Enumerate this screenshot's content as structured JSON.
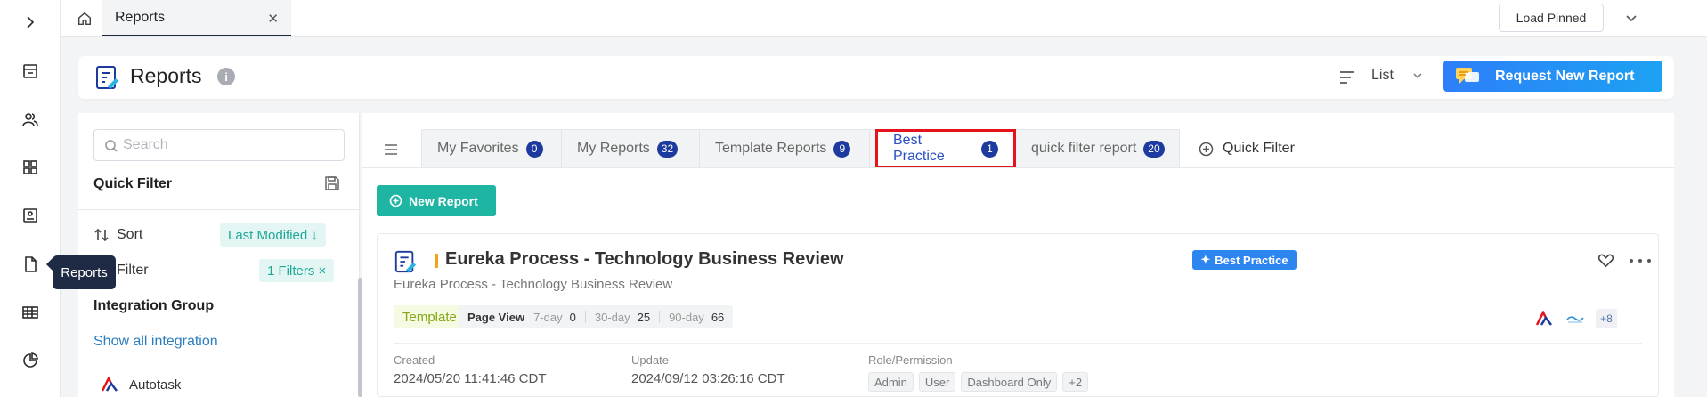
{
  "tooltip": "Reports",
  "topbar": {
    "tab_label": "Reports",
    "load_pinned": "Load Pinned"
  },
  "header": {
    "title": "Reports",
    "view_mode": "List",
    "request_button": "Request New Report"
  },
  "filter_panel": {
    "search_placeholder": "Search",
    "quick_filter_title": "Quick Filter",
    "sort_label": "Sort",
    "sort_value": "Last Modified ↓",
    "filter_label": "Filter",
    "filter_value": "1 Filters ×",
    "integration_group_title": "Integration Group",
    "show_all": "Show all integration",
    "integration_item": "Autotask"
  },
  "tabs": [
    {
      "label": "My Favorites",
      "count": "0"
    },
    {
      "label": "My Reports",
      "count": "32"
    },
    {
      "label": "Template Reports",
      "count": "9"
    },
    {
      "label": "Best Practice",
      "count": "1"
    },
    {
      "label": "quick filter report",
      "count": "20"
    }
  ],
  "quick_filter_add": "Quick Filter",
  "new_report_button": "New Report",
  "report": {
    "title": "Eureka Process - Technology Business Review",
    "subtitle": "Eureka Process - Technology Business Review",
    "badge": "Best Practice",
    "tag": "Template",
    "page_view_label": "Page View",
    "d7_label": "7-day",
    "d7_value": "0",
    "d30_label": "30-day",
    "d30_value": "25",
    "d90_label": "90-day",
    "d90_value": "66",
    "more_integrations": "+8",
    "created_label": "Created",
    "created_value": "2024/05/20 11:41:46 CDT",
    "update_label": "Update",
    "update_value": "2024/09/12 03:26:16 CDT",
    "role_label": "Role/Permission",
    "roles": [
      "Admin",
      "User",
      "Dashboard Only",
      "+2"
    ]
  },
  "colors": {
    "accent_teal": "#1fb5a3",
    "accent_blue": "#2d7ff9",
    "highlight_red": "#e3141b",
    "count_badge": "#1d3a9e"
  }
}
